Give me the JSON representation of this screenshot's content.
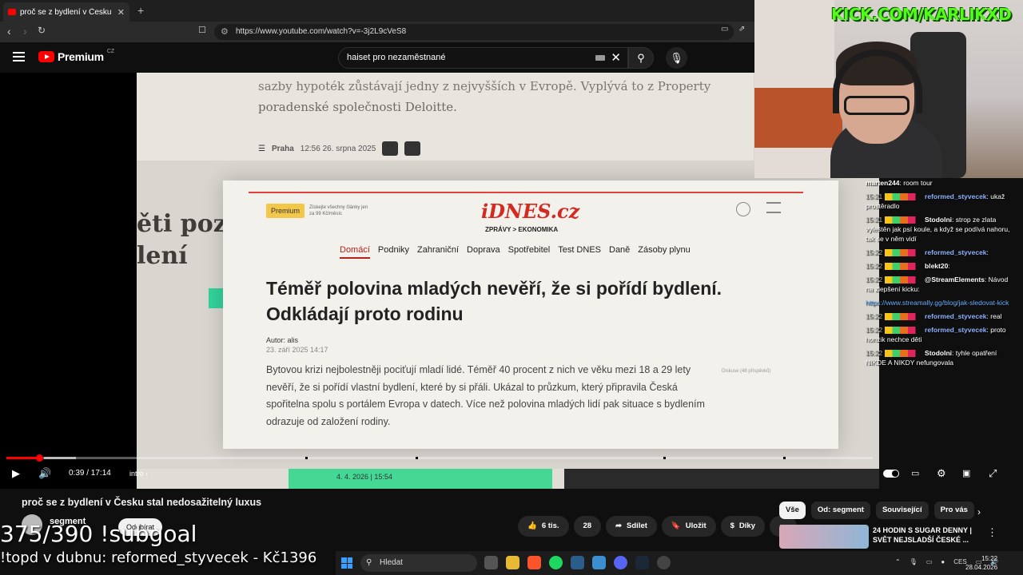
{
  "browser": {
    "tab_title": "proč se z bydlení v Česku stal nedosažitelný luxus",
    "url": "https://www.youtube.com/watch?v=-3j2L9cVeS8",
    "new_tab": "+"
  },
  "youtube": {
    "logo": "Premium",
    "region": "CZ",
    "search_query": "haiset pro nezaměstnané"
  },
  "video_frame": {
    "bg_line1": "sazby hypoték zůstávají jedny z nejvyšších v Evropě. Vyplývá to z Property",
    "bg_line2": "poradenské společnosti Deloitte.",
    "bg_city": "Praha",
    "bg_time": "12:56  26. srpna 2025",
    "left_fragment": "ěti poz\nlení",
    "premium_badge": "Premium",
    "premium_promo": "Získejte všechny články jen za 99 Kč/měsíc",
    "brand": "iDNES.cz",
    "crumbs": "ZPRÁVY  >  EKONOMIKA",
    "nav": [
      "Domácí",
      "Podniky",
      "Zahraniční",
      "Doprava",
      "Spotřebitel",
      "Test DNES",
      "Daně",
      "Zásoby plynu"
    ],
    "headline": "Téměř polovina mladých nevěří, že si pořídí bydlení. Odkládají proto rodinu",
    "author": "Autor: alis",
    "date": "23. září 2025  14:17",
    "body": "Bytovou krizi nejbolestněji pociťují mladí lidé. Téměř 40 procent z nich ve věku mezi 18 a 29 lety nevěří, že si pořídí vlastní bydlení, které by si přáli. Ukázal to průzkum, který připravila Česká spořitelna spolu s portálem Evropa v datech. Více než polovina mladých lidí pak situace s bydlením odrazuje od založení rodiny.",
    "discussion": "Diskuse (48 příspěvků)",
    "strip_date": "4. 4. 2026 | 15:54"
  },
  "player": {
    "time": "0:39 / 17:14",
    "chapter": "intro",
    "progress": 0.038
  },
  "video": {
    "title": "proč se z bydlení v Česku stal nedosažitelný luxus",
    "channel": "segment",
    "subscribe": "Odebírat",
    "likes": "6 tis.",
    "comments": "28",
    "share": "Sdílet",
    "save": "Uložit",
    "thanks": "Díky"
  },
  "chips": [
    "Vše",
    "Od: segment",
    "Související",
    "Pro vás"
  ],
  "recommended": {
    "title": "24 HODIN S SUGAR DENNY | SVĚT NEJSLADŠÍ ČESKÉ ..."
  },
  "overlay": {
    "subgoal": "375/390 !subgoal",
    "topd": "!topd v dubnu: reformed_styvecek - Kč1396",
    "kick": "KICK.COM/KARLIKXD"
  },
  "chat": [
    {
      "time": "",
      "user": "marten244",
      "color": "#ffffff",
      "text": "room tour"
    },
    {
      "time": "15:21",
      "user": "reformed_styvecek",
      "color": "#8fb4ff",
      "text": "ukaž prostěradlo"
    },
    {
      "time": "15:21",
      "user": "Stodolni",
      "color": "#ffffff",
      "text": "strop ze zlata vyleštěn jak psí koule, a když se podívá nahoru, tak se v něm vidí"
    },
    {
      "time": "15:22",
      "user": "reformed_styvecek",
      "color": "#8fb4ff",
      "text": ""
    },
    {
      "time": "15:22",
      "user": "blekt20",
      "color": "#ffffff",
      "text": ""
    },
    {
      "time": "15:22",
      "user": "@StreamElements",
      "color": "#ffffff",
      "text": "Návod na zlepšení kicku:"
    },
    {
      "time": "",
      "user": "",
      "color": "#6ab0ff",
      "text": "https://www.streamally.gg/blog/jak-sledovat-kick"
    },
    {
      "time": "15:22",
      "user": "reformed_styvecek",
      "color": "#8fb4ff",
      "text": "real"
    },
    {
      "time": "15:22",
      "user": "reformed_styvecek",
      "color": "#8fb4ff",
      "text": "proto honzik nechce děti"
    },
    {
      "time": "15:22",
      "user": "Stodolni",
      "color": "#ffffff",
      "text": "tyhle opatření NIKDE A NIKDY nefungovala"
    }
  ],
  "taskbar": {
    "search": "Hledat",
    "lang": "CES",
    "time": "15:22",
    "date": "28.04.2026"
  }
}
